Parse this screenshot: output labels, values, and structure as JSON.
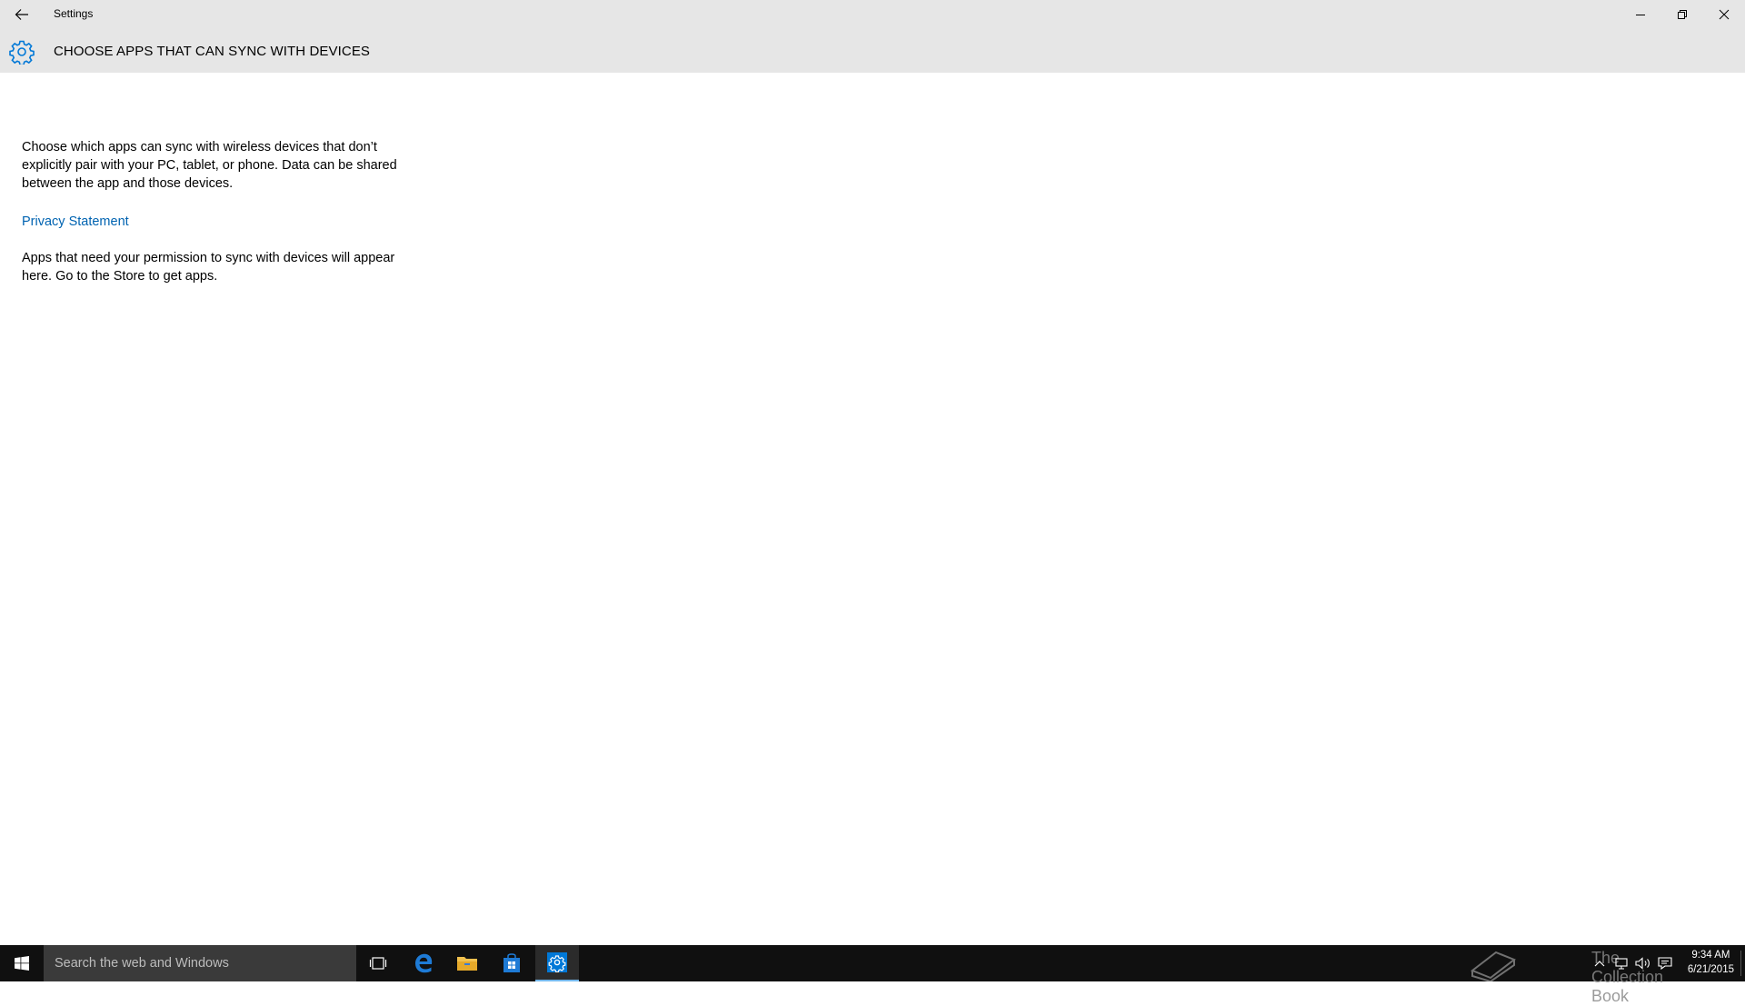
{
  "window": {
    "app_title": "Settings",
    "controls": [
      "minimize",
      "restore",
      "close"
    ]
  },
  "header": {
    "page_title": "CHOOSE APPS THAT CAN SYNC WITH DEVICES",
    "icon": "gear-icon"
  },
  "content": {
    "description": "Choose which apps can sync with wireless devices that don’t explicitly pair with your PC, tablet, or phone. Data can be shared between the app and those devices.",
    "privacy_link": "Privacy Statement",
    "empty_message": "Apps that need your permission to sync with devices will appear here. Go to the Store to get apps."
  },
  "taskbar": {
    "search_placeholder": "Search the web and Windows",
    "apps": [
      "task-view-icon",
      "edge-icon",
      "file-explorer-icon",
      "store-icon",
      "settings-icon"
    ],
    "active_app": "settings-icon",
    "tray": {
      "watermark": "The Collection Book",
      "time": "9:34 AM",
      "date": "6/21/2015"
    }
  },
  "colors": {
    "accent": "#0078d7",
    "link": "#0063b1",
    "titlebar_bg": "#e6e6e6",
    "taskbar_bg": "#101010"
  }
}
